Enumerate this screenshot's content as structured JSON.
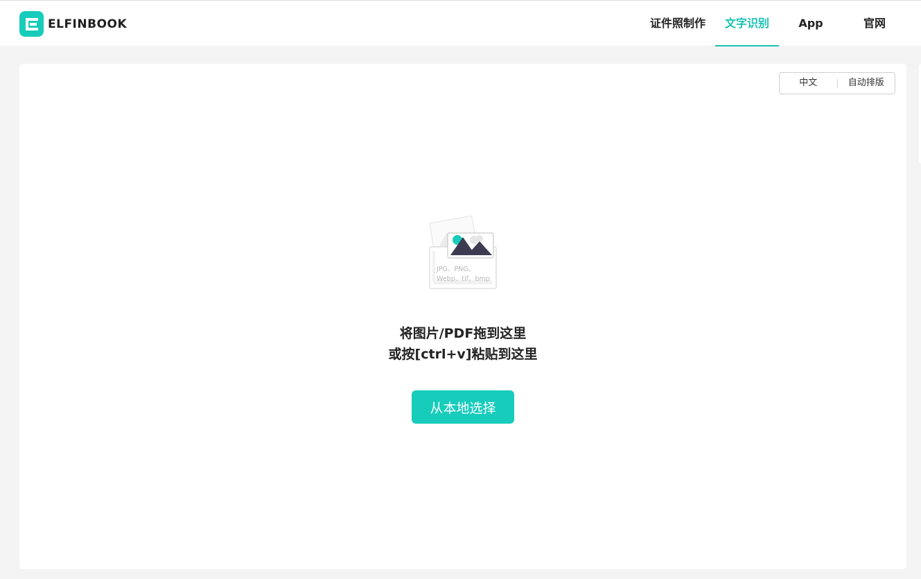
{
  "header": {
    "logo_text": "ELFINBOOK",
    "nav": [
      {
        "label": "证件照制作",
        "active": false
      },
      {
        "label": "文字识别",
        "active": true
      },
      {
        "label": "App",
        "active": false
      },
      {
        "label": "官网",
        "active": false
      }
    ]
  },
  "options": {
    "language": "中文",
    "layout": "自动排版"
  },
  "upload": {
    "illustration_caption_line1": "JPG、PNG、",
    "illustration_caption_line2": "Webp、tif、bmp",
    "hint_line1": "将图片/PDF拖到这里",
    "hint_line2": "或按[ctrl+v]粘贴到这里",
    "choose_button": "从本地选择"
  },
  "colors": {
    "accent": "#17ccbb",
    "accent_text": "#17c2b2",
    "background": "#f4f4f4",
    "card": "#ffffff"
  }
}
